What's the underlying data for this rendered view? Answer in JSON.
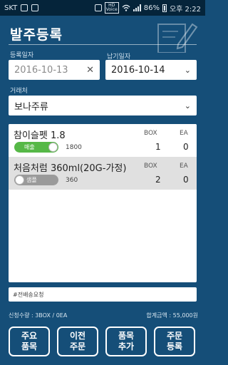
{
  "status_bar": {
    "carrier": "SKT",
    "voice_label": "HD\nVoice",
    "battery": "86%",
    "time": "오후 2:22"
  },
  "header": {
    "title": "발주등록",
    "decor_icon": "notepad-pencil-icon"
  },
  "form": {
    "register_date_label": "등록일자",
    "register_date_value": "2016-10-13",
    "due_date_label": "납기일자",
    "due_date_value": "2016-10-14",
    "client_label": "거래처",
    "client_value": "보나주류"
  },
  "items": {
    "rows": [
      {
        "name": "참이슬펫 1.8",
        "box_header": "BOX",
        "ea_header": "EA",
        "toggle_label": "매출",
        "toggle_state": "on",
        "price": "1800",
        "box": "1",
        "ea": "0"
      },
      {
        "name": "처음처럼 360ml(20G-가정)",
        "box_header": "BOX",
        "ea_header": "EA",
        "toggle_label": "샘플",
        "toggle_state": "off",
        "price": "360",
        "box": "2",
        "ea": "0"
      }
    ]
  },
  "memo": {
    "value": "#전배송요청"
  },
  "summary": {
    "quantity": "신청수량 : 3BOX / 0EA",
    "total": "합계금액 : 55,000원"
  },
  "buttons": {
    "main_items_line1": "주요",
    "main_items_line2": "품목",
    "previous_order_line1": "이전",
    "previous_order_line2": "주문",
    "add_item_line1": "품목",
    "add_item_line2": "추가",
    "register_order_line1": "주문",
    "register_order_line2": "등록"
  },
  "colors": {
    "background": "#154e78",
    "status_bar": "#05243a",
    "toggle_on": "#56b847",
    "toggle_off": "#9a9a9a",
    "selected_row": "#e0e0e0"
  }
}
